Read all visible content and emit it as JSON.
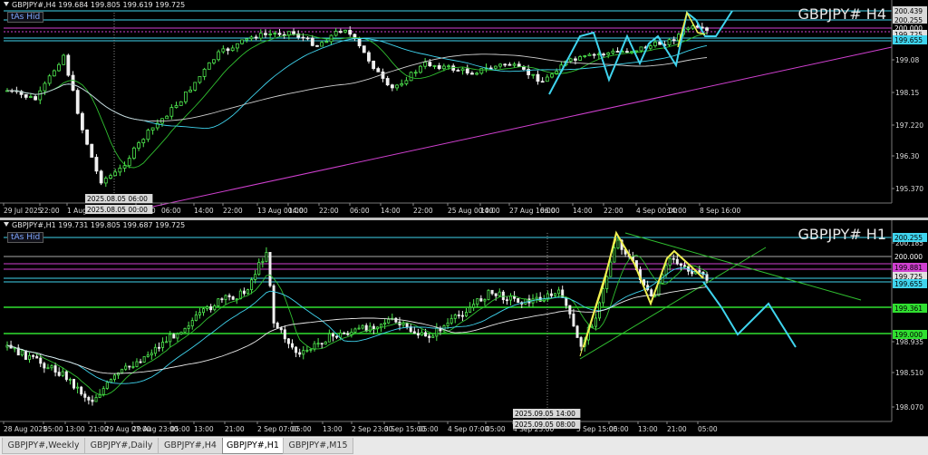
{
  "window": {
    "h4_info": "GBPJPY#,H4  199.684 199.805 199.619 199.725",
    "h1_info": "GBPJPY#,H1  199.731 199.805 199.687 199.725",
    "indicator_label": "tAs Hid",
    "h4_title": "GBPJPY# H4",
    "h1_title": "GBPJPY# H1"
  },
  "h4": {
    "price_labels": [
      "200.439",
      "200.255",
      "200.000",
      "199.725",
      "199.655"
    ],
    "price_scale": [
      "199.08",
      "198.15",
      "197.220",
      "196.30",
      "195.370"
    ],
    "time_labels": [
      "29 Jul 2025",
      "22:00",
      "1 Aug",
      "06:00",
      "16:00",
      "06:00",
      "14:00",
      "22:00",
      "8 Aug 08:00",
      "13 Aug 00:00",
      "06:00",
      "14:00",
      "22:00",
      "15 Aug 16:00",
      "06:00",
      "14:00",
      "20 Aug 08:00",
      "22:00",
      "25 Aug 00:00",
      "14:00",
      "22:00",
      "27 Aug 16:00",
      "06:00",
      "1 Sep 08:00",
      "14:00",
      "22:00",
      "06:00",
      "4 Sep 00:00",
      "14:00",
      "22:00",
      "8 Sep 16:00"
    ],
    "cursor_date": "2025.08.05 06:00",
    "cursor_date2": "2025.08.05 00:00"
  },
  "h1": {
    "price_labels": [
      "200.255",
      "200.000",
      "199.881",
      "199.725",
      "199.655",
      "199.361",
      "199.000"
    ],
    "price_scale": [
      "200.185",
      "198.935",
      "198.510",
      "198.070"
    ],
    "time_labels": [
      "28 Aug 2025",
      "05:00",
      "13:00",
      "21:00",
      "29 Aug 07:00",
      "05:00",
      "29 Aug 23:00",
      "05:00",
      "13:00",
      "21:00",
      "1 Sep 15:00",
      "05:00",
      "13:00",
      "21:00",
      "2 Sep 07:00",
      "05:00",
      "13:00",
      "2 Sep 23:00",
      "05:00",
      "13:00",
      "21:00",
      "3 Sep 15:00",
      "05:00",
      "13:00",
      "21:00",
      "4 Sep 07:00",
      "05:00",
      "13:00",
      "4 Sep 23:00",
      "21:00",
      "5 Sep 15:00",
      "05:00",
      "13:00",
      "21:00",
      "8 Sep 07:00",
      "05:00",
      "8 Sep 23:00"
    ],
    "cursor_date": "2025.09.05 14:00",
    "cursor_date2": "2025.09.05 08:00"
  },
  "tabs": [
    "GBPJPY#,Weekly",
    "GBPJPY#,Daily",
    "GBPJPY#,H4",
    "GBPJPY#,H1",
    "GBPJPY#,M15"
  ],
  "active_tab": "GBPJPY#,H1",
  "colors": {
    "bull": "#4fe84f",
    "bear": "#f0f0f0",
    "cyan": "#3fd4ee",
    "yellow": "#f0f050",
    "magenta": "#d040d0",
    "green_level": "#30e030"
  }
}
